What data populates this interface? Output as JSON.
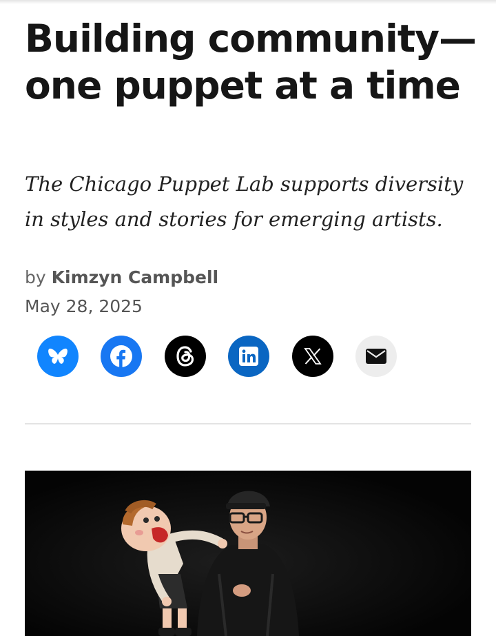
{
  "article": {
    "headline": "Building community—one puppet at a time",
    "dek": "The Chicago Puppet Lab supports diversity in styles and stories for emerging artists.",
    "byline_prefix": "by",
    "author": "Kimzyn Campbell",
    "date": "May 28, 2025"
  },
  "share": [
    {
      "name": "bluesky",
      "icon": "butterfly-icon",
      "color": "#1185fe"
    },
    {
      "name": "facebook",
      "icon": "facebook-icon",
      "color": "#1877f2"
    },
    {
      "name": "threads",
      "icon": "threads-icon",
      "color": "#000000"
    },
    {
      "name": "linkedin",
      "icon": "linkedin-icon",
      "color": "#0a66c2"
    },
    {
      "name": "x",
      "icon": "x-icon",
      "color": "#000000"
    },
    {
      "name": "email",
      "icon": "envelope-icon",
      "color": "#ededed"
    }
  ]
}
